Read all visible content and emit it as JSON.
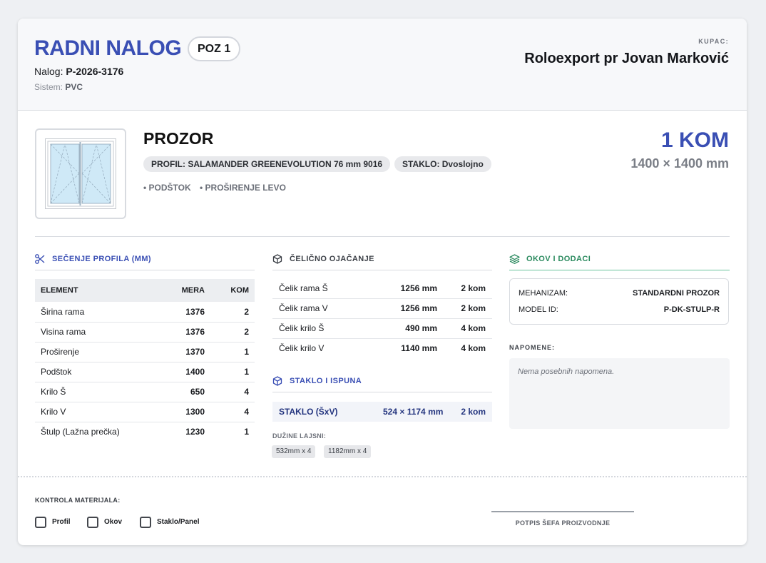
{
  "header": {
    "title": "RADNI NALOG",
    "position_badge": "POZ 1",
    "order_label": "Nalog:",
    "order_number": "P-2026-3176",
    "system_label": "Sistem:",
    "system_value": "PVC",
    "customer_label": "KUPAC:",
    "customer_name": "Roloexport pr Jovan Marković"
  },
  "item": {
    "type": "PROZOR",
    "profile_tag": "PROFIL: SALAMANDER GREENEVOLUTION 76 mm 9016",
    "glass_tag": "STAKLO: Dvoslojno",
    "options": [
      "• PODŠTOK",
      "• PROŠIRENJE LEVO"
    ],
    "quantity": "1 KOM",
    "dimensions": "1400 × 1400 mm"
  },
  "cutting": {
    "title": "SEČENJE PROFILA (MM)",
    "columns": [
      "ELEMENT",
      "MERA",
      "KOM"
    ],
    "rows": [
      [
        "Širina rama",
        "1376",
        "2"
      ],
      [
        "Visina rama",
        "1376",
        "2"
      ],
      [
        "Proširenje",
        "1370",
        "1"
      ],
      [
        "Podštok",
        "1400",
        "1"
      ],
      [
        "Krilo Š",
        "650",
        "4"
      ],
      [
        "Krilo V",
        "1300",
        "4"
      ],
      [
        "Štulp (Lažna prečka)",
        "1230",
        "1"
      ]
    ]
  },
  "steel": {
    "title": "ČELIČNO OJAČANJE",
    "rows": [
      [
        "Čelik rama Š",
        "1256 mm",
        "2 kom"
      ],
      [
        "Čelik rama V",
        "1256 mm",
        "2 kom"
      ],
      [
        "Čelik krilo Š",
        "490 mm",
        "4 kom"
      ],
      [
        "Čelik krilo V",
        "1140 mm",
        "4 kom"
      ]
    ]
  },
  "glass": {
    "title": "STAKLO I ISPUNA",
    "label": "STAKLO (ŠxV)",
    "size": "524 × 1174 mm",
    "count": "2 kom",
    "strips_label": "DUŽINE LAJSNI:",
    "strips": [
      "532mm x 4",
      "1182mm x 4"
    ]
  },
  "hardware": {
    "title": "OKOV I DODACI",
    "mechanism_label": "MEHANIZAM:",
    "mechanism_value": "STANDARDNI PROZOR",
    "model_label": "MODEL ID:",
    "model_value": "P-DK-STULP-R"
  },
  "notes": {
    "label": "NAPOMENE:",
    "text": "Nema posebnih napomena."
  },
  "footer": {
    "control_label": "KONTROLA MATERIJALA:",
    "checks": [
      "Profil",
      "Okov",
      "Staklo/Panel"
    ],
    "signature_label": "POTPIS ŠEFA PROIZVODNJE"
  },
  "colors": {
    "accent": "#3a4fb4",
    "hardware_green": "#2a8a5e",
    "glass_fill": "#cfe9f7"
  }
}
